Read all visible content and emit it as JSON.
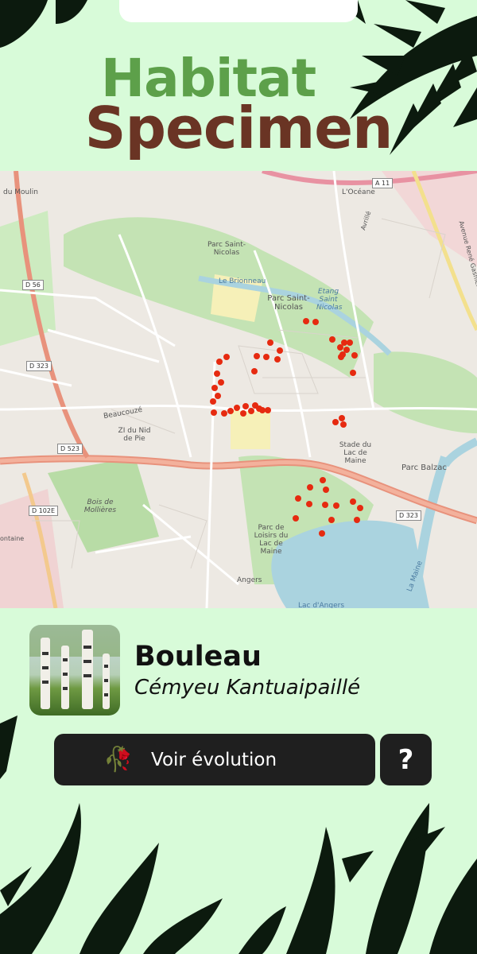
{
  "header": {
    "title_line1": "Habitat",
    "title_line2": "Specimen"
  },
  "map": {
    "labels": [
      "du Moulin",
      "Parc Saint-Nicolas",
      "Le Brionneau",
      "Parc Saint-Nicolas",
      "Etang Saint Nicolas",
      "L'Océane",
      "Beaucouzé",
      "ZI du Nid de Pie",
      "Bois de Mollières",
      "Stade du Lac de Maine",
      "Parc Balzac",
      "Parc de Loisirs du Lac de Maine",
      "Angers",
      "Lac d'Angers",
      "La Maine",
      "Avenue René Gasnier",
      "ontaine",
      "Avrillé"
    ],
    "road_tags": [
      "D 56",
      "D 323",
      "D 523",
      "D 102E",
      "A 11",
      "D 323"
    ],
    "observation_color": "#e62a10"
  },
  "species": {
    "common_name": "Bouleau",
    "latin_name": "Cémyeu Kantuaipaillé"
  },
  "actions": {
    "evolution_icon": "🥀",
    "evolution_label": "Voir évolution",
    "help_label": "?"
  },
  "colors": {
    "background": "#d8fbd9",
    "title_green": "#5da04a",
    "title_brown": "#6a3424",
    "button_dark": "#1f1f1f"
  }
}
